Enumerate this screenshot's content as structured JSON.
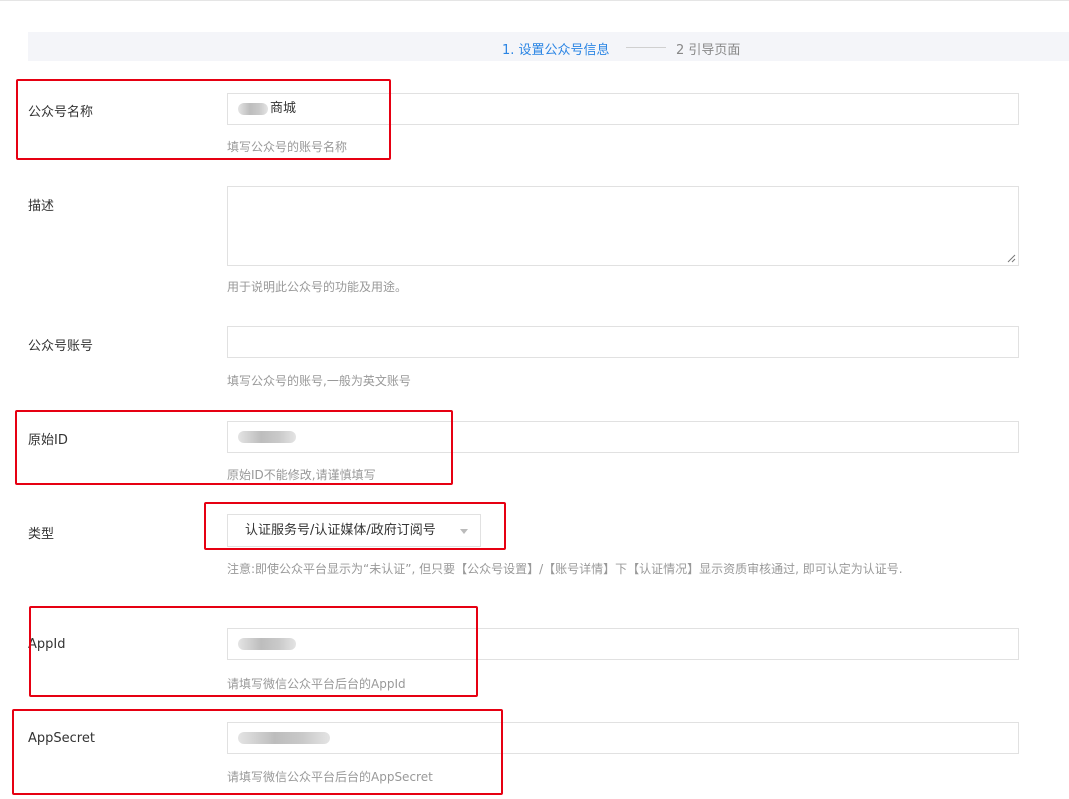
{
  "steps": {
    "step1": "1. 设置公众号信息",
    "step2": "2 引导页面"
  },
  "form": {
    "name": {
      "label": "公众号名称",
      "value_suffix": "商城",
      "help": "填写公众号的账号名称"
    },
    "description": {
      "label": "描述",
      "value": "",
      "help": "用于说明此公众号的功能及用途。"
    },
    "account": {
      "label": "公众号账号",
      "value": "",
      "help": "填写公众号的账号,一般为英文账号"
    },
    "original_id": {
      "label": "原始ID",
      "help": "原始ID不能修改,请谨慎填写"
    },
    "type": {
      "label": "类型",
      "selected": "认证服务号/认证媒体/政府订阅号",
      "help": "注意:即使公众平台显示为“未认证”, 但只要【公众号设置】/【账号详情】下【认证情况】显示资质审核通过, 即可认定为认证号."
    },
    "appid": {
      "label": "AppId",
      "help": "请填写微信公众平台后台的AppId"
    },
    "appsecret": {
      "label": "AppSecret",
      "help": "请填写微信公众平台后台的AppSecret"
    }
  },
  "colors": {
    "step_active": "#2b85e4",
    "annotation_red": "#e60012",
    "help_text": "#999999"
  }
}
